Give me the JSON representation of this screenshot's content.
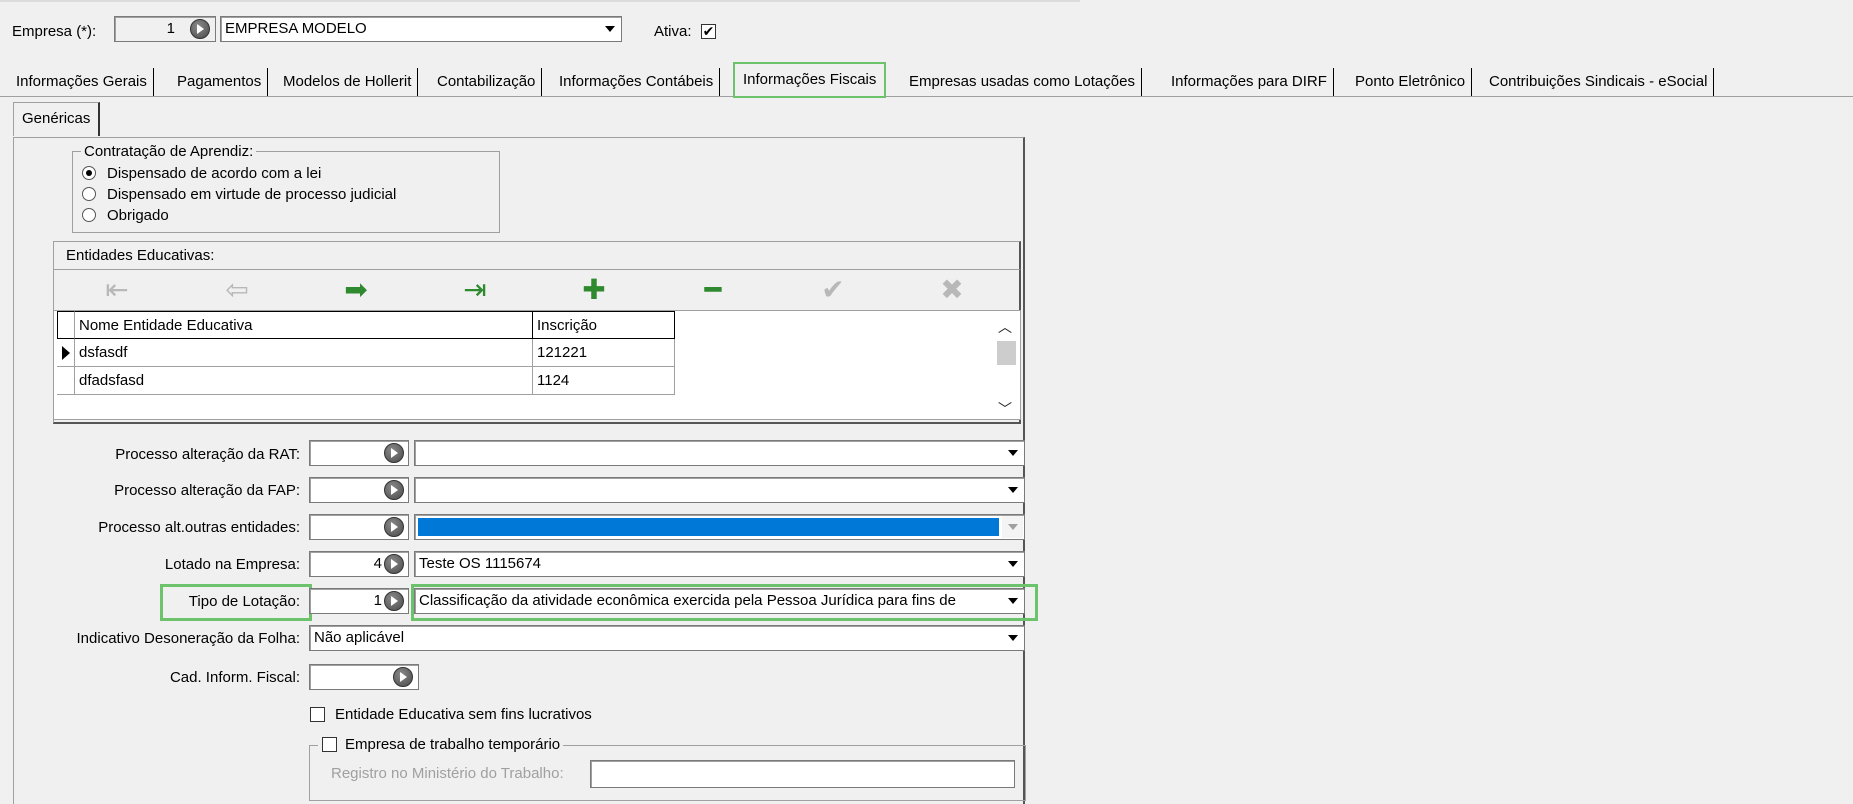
{
  "header": {
    "empresa_label": "Empresa (*):",
    "empresa_code": "1",
    "empresa_name": "EMPRESA MODELO",
    "ativa_label": "Ativa:",
    "ativa_checked": "✔"
  },
  "tabs": [
    {
      "label": "Informações Gerais"
    },
    {
      "label": "Pagamentos"
    },
    {
      "label": "Modelos de Hollerit"
    },
    {
      "label": "Contabilização"
    },
    {
      "label": "Informações Contábeis"
    },
    {
      "label": "Informações Fiscais"
    },
    {
      "label": "Empresas usadas como Lotações"
    },
    {
      "label": "Informações para DIRF"
    },
    {
      "label": "Ponto Eletrônico"
    },
    {
      "label": "Contribuições Sindicais - eSocial"
    }
  ],
  "subtab": {
    "label": "Genéricas"
  },
  "aprendiz": {
    "title": "Contratação de Aprendiz:",
    "options": [
      {
        "label": "Dispensado de acordo com a lei",
        "selected": true
      },
      {
        "label": "Dispensado em virtude de processo judicial",
        "selected": false
      },
      {
        "label": "Obrigado",
        "selected": false
      }
    ]
  },
  "entidades": {
    "title": "Entidades Educativas:",
    "nav_icons": [
      "first-icon",
      "prior-icon",
      "next-icon",
      "last-icon",
      "insert-icon",
      "delete-icon",
      "post-icon",
      "cancel-icon"
    ],
    "columns": [
      "Nome Entidade Educativa",
      "Inscrição"
    ],
    "rows": [
      [
        "dsfasdf",
        "121221"
      ],
      [
        "dfadsfasd",
        "1124"
      ]
    ]
  },
  "form": {
    "rat_label": "Processo alteração da RAT:",
    "rat_code": "",
    "rat_desc": "",
    "fap_label": "Processo alteração da FAP:",
    "fap_code": "",
    "fap_desc": "",
    "outras_label": "Processo alt.outras entidades:",
    "outras_code": "",
    "outras_desc": "",
    "lotado_label": "Lotado na Empresa:",
    "lotado_code": "4",
    "lotado_desc": "Teste OS 1115674",
    "tipo_label": "Tipo de Lotação:",
    "tipo_code": "1",
    "tipo_desc": "Classificação da atividade econômica exercida pela Pessoa Jurídica para fins de",
    "desoneracao_label": "Indicativo Desoneração da Folha:",
    "desoneracao_value": "Não aplicável",
    "cad_label": "Cad. Inform. Fiscal:",
    "cad_value": "",
    "entidade_sem_fins_label": "Entidade Educativa sem fins lucrativos",
    "temporario_label": "Empresa de trabalho temporário",
    "registro_label": "Registro no Ministério do Trabalho:",
    "registro_value": ""
  },
  "colors": {
    "highlight": "#6cc36c",
    "selection": "#0078d7"
  }
}
